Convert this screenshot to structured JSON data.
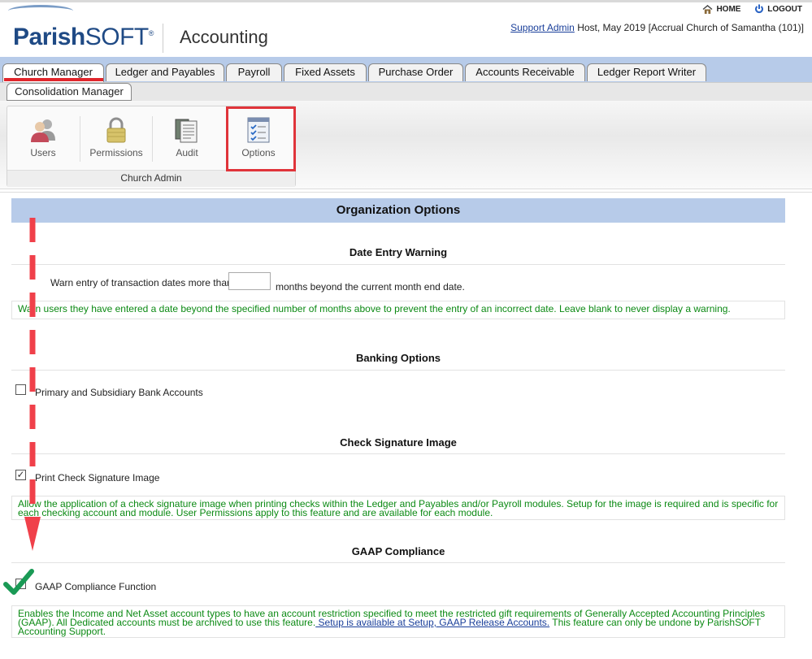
{
  "header": {
    "logo_bold": "Parish",
    "logo_light": "SOFT",
    "app_title": "Accounting",
    "home_label": "HOME",
    "logout_label": "LOGOUT",
    "user_link": "Support Admin",
    "user_context": "Host, May 2019 [Accrual Church of Samantha (101)]"
  },
  "tabs": [
    {
      "label": "Church Manager",
      "active": true
    },
    {
      "label": "Ledger and Payables"
    },
    {
      "label": "Payroll"
    },
    {
      "label": "Fixed Assets"
    },
    {
      "label": "Purchase Order"
    },
    {
      "label": "Accounts Receivable"
    },
    {
      "label": "Ledger Report Writer"
    }
  ],
  "subtab": {
    "label": "Consolidation Manager"
  },
  "ribbon": {
    "group_label": "Church Admin",
    "buttons": [
      {
        "label": "Users",
        "icon": "users-icon"
      },
      {
        "label": "Permissions",
        "icon": "lock-icon"
      },
      {
        "label": "Audit",
        "icon": "audit-icon"
      },
      {
        "label": "Options",
        "icon": "checklist-icon"
      }
    ]
  },
  "main": {
    "title": "Organization Options",
    "date_warning": {
      "title": "Date Entry Warning",
      "prefix": "Warn entry of transaction dates more than",
      "value": "",
      "suffix": "months beyond the current month end date.",
      "help": "Warn users they have entered a date beyond the specified number of months above to prevent the entry of an incorrect date. Leave blank to never display a warning."
    },
    "banking": {
      "title": "Banking Options",
      "checkbox_label": "Primary and Subsidiary Bank Accounts",
      "checked": false
    },
    "check_signature": {
      "title": "Check Signature Image",
      "checkbox_label": "Print Check Signature Image",
      "checked": true,
      "help": "Allow the application of a check signature image when printing checks within the Ledger and Payables and/or Payroll modules. Setup for the image is required and is specific for each checking account and module. User Permissions apply to this feature and are available for each module."
    },
    "gaap": {
      "title": "GAAP Compliance",
      "checkbox_label": "GAAP Compliance Function",
      "checked": false,
      "help_part1": "Enables the Income and Net Asset account types to have an account restriction specified to meet the restricted gift requirements of Generally Accepted Accounting Principles (GAAP). All Dedicated accounts must be archived to use this feature.",
      "help_link": " Setup is available at Setup, GAAP Release Accounts.",
      "help_part2": " This feature can only be undone by ParishSOFT Accounting Support."
    }
  },
  "colors": {
    "tabbar": "#b7cbe9",
    "help_text": "#0c8a14",
    "annotation_red": "#e0343a",
    "annotation_check": "#1a9a55"
  }
}
